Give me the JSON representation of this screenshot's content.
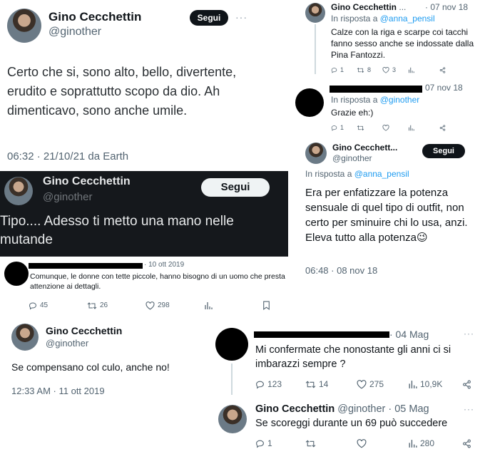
{
  "tweet1": {
    "name": "Gino Cecchettin",
    "handle": "@ginother",
    "follow": "Segui",
    "more": "···",
    "text": "Certo che si, sono alto, bello, divertente, erudito e soprattutto scopo da dio. Ah dimenticavo, sono anche umile.",
    "meta": "06:32 · 21/10/21 da Earth"
  },
  "tweet2": {
    "name": "Gino Cecchettin",
    "handle": "@ginother",
    "follow": "Segui",
    "text": "Tipo.... Adesso ti metto una mano nelle mutande"
  },
  "tweet3": {
    "date": "· 10 ott 2019",
    "text": "Comunque, le donne con tette piccole, hanno bisogno di un uomo che presta attenzione ai dettagli.",
    "replies": "45",
    "retweets": "26",
    "likes": "298"
  },
  "tweet4": {
    "name": "Gino Cecchettin",
    "handle": "@ginother",
    "text": "Se compensano col culo, anche no!",
    "meta": "12:33 AM · 11 ott 2019"
  },
  "tweet5": {
    "name": "Gino Cecchettin",
    "name_trunc": "...",
    "date": "· 07 nov 18",
    "reply_prefix": "In risposta a",
    "reply_to": "@anna_pensil",
    "text": "Calze con la riga e scarpe coi tacchi fanno sesso anche se indossate dalla Pina Fantozzi.",
    "replies": "1",
    "retweets": "8",
    "likes": "3"
  },
  "tweet6": {
    "date": "07 nov 18",
    "reply_prefix": "In risposta a",
    "reply_to": "@ginother",
    "text": "Grazie eh:)",
    "replies": "1"
  },
  "tweet7": {
    "name": "Gino Cecchett...",
    "handle": "@ginother",
    "follow": "Segui",
    "reply_prefix": "In risposta a",
    "reply_to": "@anna_pensil",
    "text": "Era per enfatizzare la potenza sensuale di quel tipo di outfit, non certo per sminuire chi lo usa, anzi. Eleva tutto alla potenza",
    "emoji": "😉",
    "meta": "06:48 · 08 nov 18"
  },
  "tweet8": {
    "date": "· 04 Mag",
    "more": "···",
    "text": "Mi confermate che nonostante gli anni ci si imbarazzi sempre ?",
    "replies": "123",
    "retweets": "14",
    "likes": "275",
    "views": "10,9K"
  },
  "tweet9": {
    "name": "Gino Cecchettin",
    "handle": "@ginother",
    "date": "· 05 Mag",
    "more": "···",
    "text": "Se scoreggi durante un 69 può succedere",
    "replies": "1",
    "views": "280"
  }
}
